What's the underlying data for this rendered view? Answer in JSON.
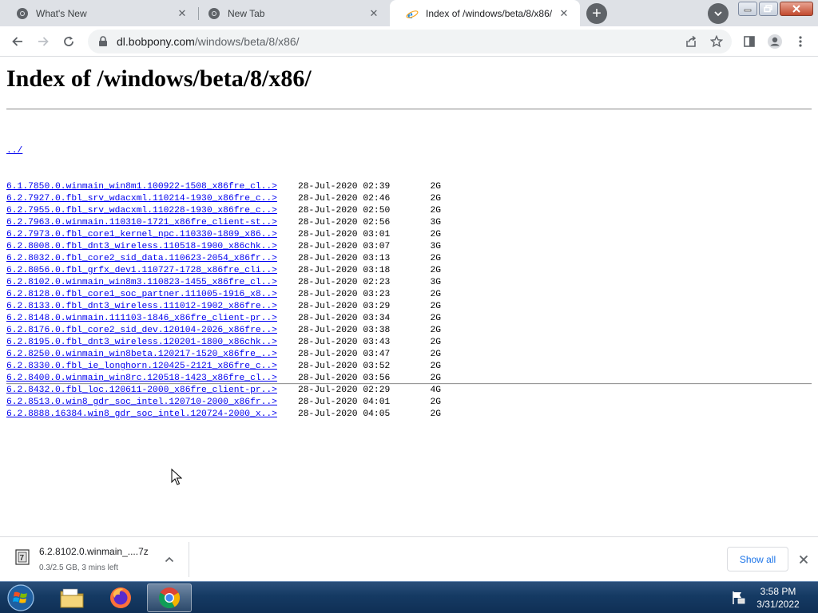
{
  "browser": {
    "tabs": [
      {
        "title": "What's New",
        "active": false
      },
      {
        "title": "New Tab",
        "active": false
      },
      {
        "title": "Index of /windows/beta/8/x86/",
        "active": true
      }
    ],
    "url_host": "dl.bobpony.com",
    "url_path": "/windows/beta/8/x86/"
  },
  "page": {
    "title": "Index of /windows/beta/8/x86/",
    "parent_link": "../",
    "entries": [
      {
        "name": "6.1.7850.0.winmain_win8m1.100922-1508_x86fre_cl..>",
        "date": "28-Jul-2020 02:39",
        "size": "2G"
      },
      {
        "name": "6.2.7927.0.fbl_srv_wdacxml.110214-1930_x86fre_c..>",
        "date": "28-Jul-2020 02:46",
        "size": "2G"
      },
      {
        "name": "6.2.7955.0.fbl_srv_wdacxml.110228-1930_x86fre_c..>",
        "date": "28-Jul-2020 02:50",
        "size": "2G"
      },
      {
        "name": "6.2.7963.0.winmain.110310-1721_x86fre_client-st..>",
        "date": "28-Jul-2020 02:56",
        "size": "3G"
      },
      {
        "name": "6.2.7973.0.fbl_core1_kernel_npc.110330-1809_x86..>",
        "date": "28-Jul-2020 03:01",
        "size": "2G"
      },
      {
        "name": "6.2.8008.0.fbl_dnt3_wireless.110518-1900_x86chk..>",
        "date": "28-Jul-2020 03:07",
        "size": "3G"
      },
      {
        "name": "6.2.8032.0.fbl_core2_sid_data.110623-2054_x86fr..>",
        "date": "28-Jul-2020 03:13",
        "size": "2G"
      },
      {
        "name": "6.2.8056.0.fbl_grfx_dev1.110727-1728_x86fre_cli..>",
        "date": "28-Jul-2020 03:18",
        "size": "2G"
      },
      {
        "name": "6.2.8102.0.winmain_win8m3.110823-1455_x86fre_cl..>",
        "date": "28-Jul-2020 02:23",
        "size": "3G"
      },
      {
        "name": "6.2.8128.0.fbl_core1_soc_partner.111005-1916_x8..>",
        "date": "28-Jul-2020 03:23",
        "size": "2G"
      },
      {
        "name": "6.2.8133.0.fbl_dnt3_wireless.111012-1902_x86fre..>",
        "date": "28-Jul-2020 03:29",
        "size": "2G"
      },
      {
        "name": "6.2.8148.0.winmain.111103-1846_x86fre_client-pr..>",
        "date": "28-Jul-2020 03:34",
        "size": "2G"
      },
      {
        "name": "6.2.8176.0.fbl_core2_sid_dev.120104-2026_x86fre..>",
        "date": "28-Jul-2020 03:38",
        "size": "2G"
      },
      {
        "name": "6.2.8195.0.fbl_dnt3_wireless.120201-1800_x86chk..>",
        "date": "28-Jul-2020 03:43",
        "size": "2G"
      },
      {
        "name": "6.2.8250.0.winmain_win8beta.120217-1520_x86fre_..>",
        "date": "28-Jul-2020 03:47",
        "size": "2G"
      },
      {
        "name": "6.2.8330.0.fbl_ie_longhorn.120425-2121_x86fre_c..>",
        "date": "28-Jul-2020 03:52",
        "size": "2G"
      },
      {
        "name": "6.2.8400.0.winmain_win8rc.120518-1423_x86fre_cl..>",
        "date": "28-Jul-2020 03:56",
        "size": "2G"
      },
      {
        "name": "6.2.8432.0.fbl_loc.120611-2000_x86fre_client-pr..>",
        "date": "28-Jul-2020 02:29",
        "size": "4G"
      },
      {
        "name": "6.2.8513.0.win8_gdr_soc_intel.120710-2000_x86fr..>",
        "date": "28-Jul-2020 04:01",
        "size": "2G"
      },
      {
        "name": "6.2.8888.16384.win8_gdr_soc_intel.120724-2000_x..>",
        "date": "28-Jul-2020 04:05",
        "size": "2G"
      }
    ]
  },
  "download_shelf": {
    "filename": "6.2.8102.0.winmain_....7z",
    "status": "0.3/2.5 GB, 3 mins left",
    "show_all_label": "Show all"
  },
  "taskbar": {
    "apps": [
      "windows-explorer",
      "firefox",
      "chrome"
    ],
    "active_app": "chrome",
    "time": "3:58 PM",
    "date": "3/31/2022"
  },
  "colors": {
    "link": "#0000ee",
    "tabstrip_bg": "#dee1e6",
    "omnibox_bg": "#f1f3f4",
    "accent_blue": "#1a73e8",
    "taskbar_bg": "#153a63"
  }
}
